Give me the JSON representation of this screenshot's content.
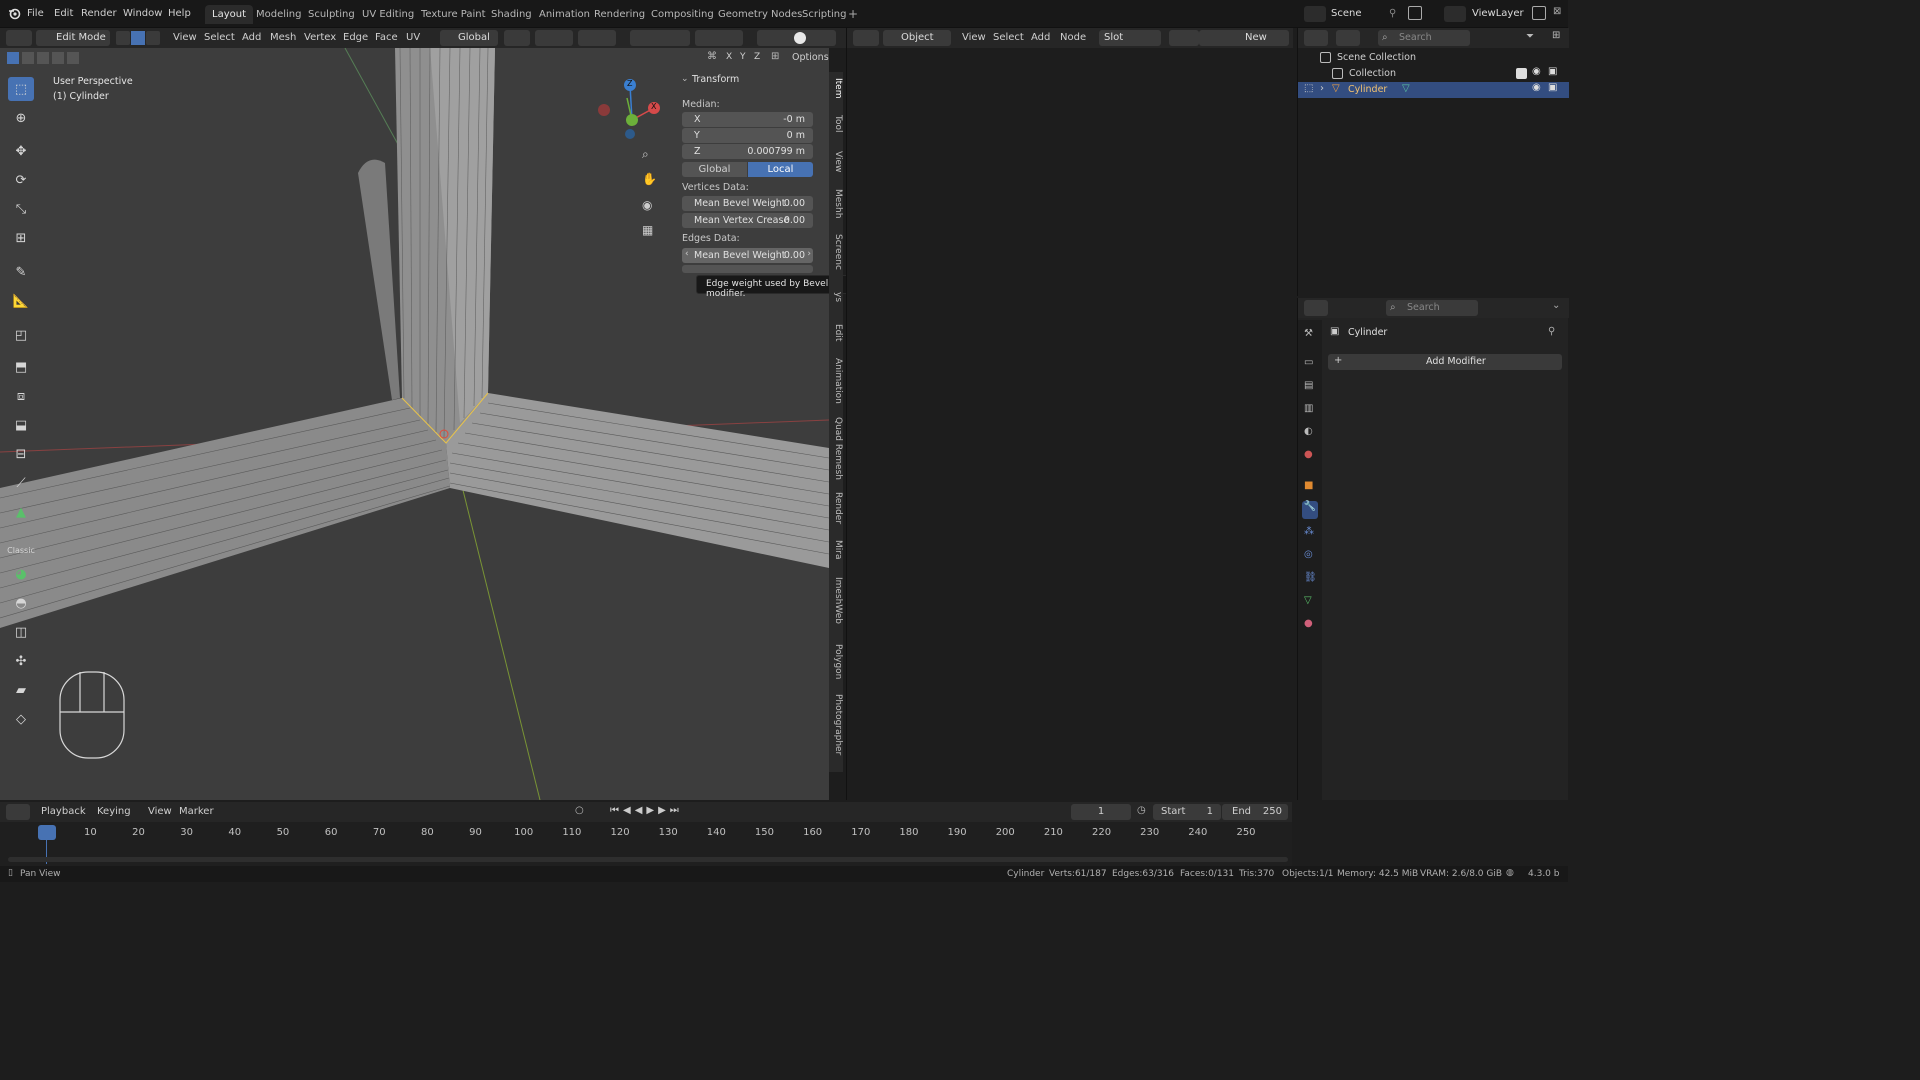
{
  "menubar": {
    "items": [
      "File",
      "Edit",
      "Render",
      "Window",
      "Help"
    ],
    "workspaces": [
      "Layout",
      "Modeling",
      "Sculpting",
      "UV Editing",
      "Texture Paint",
      "Shading",
      "Animation",
      "Rendering",
      "Compositing",
      "Geometry Nodes",
      "Scripting"
    ],
    "active_workspace": "Layout",
    "scene": "Scene",
    "view_layer": "ViewLayer"
  },
  "viewport_header": {
    "mode": "Edit Mode",
    "menus": [
      "View",
      "Select",
      "Add",
      "Mesh",
      "Vertex",
      "Edge",
      "Face",
      "UV"
    ],
    "orientation": "Global",
    "options_label": "Options",
    "axes": [
      "X",
      "Y",
      "Z"
    ]
  },
  "viewport": {
    "view_name": "User Perspective",
    "object_name": "(1) Cylinder",
    "gizmo_labels": [
      "X",
      "Y",
      "Z"
    ]
  },
  "npanel": {
    "section": "Transform",
    "median_label": "Median:",
    "fields": [
      {
        "label": "X",
        "value": "-0 m"
      },
      {
        "label": "Y",
        "value": "0 m"
      },
      {
        "label": "Z",
        "value": "0.000799 m"
      }
    ],
    "space_buttons": [
      "Global",
      "Local"
    ],
    "active_space": "Local",
    "vertices_label": "Vertices Data:",
    "vertex_fields": [
      {
        "label": "Mean Bevel Weight",
        "value": "0.00"
      },
      {
        "label": "Mean Vertex Crease",
        "value": "0.00"
      }
    ],
    "edges_label": "Edges Data:",
    "edge_fields": [
      {
        "label": "Mean Bevel Weight",
        "value": "0.00"
      }
    ],
    "tooltip": "Edge weight used by Bevel modifier."
  },
  "side_tabs": [
    "Item",
    "Tool",
    "View",
    "Meshh",
    "Screenc",
    "ys",
    "Edit",
    "Animation",
    "Quad Remesh",
    "Render",
    "Mira",
    "ImeshWeb",
    "Polygon",
    "Photographer"
  ],
  "node_header": {
    "object_label": "Object",
    "menus": [
      "View",
      "Select",
      "Add",
      "Node"
    ],
    "slot_label": "Slot",
    "new_label": "New"
  },
  "outliner": {
    "search_placeholder": "Search",
    "items": [
      {
        "label": "Scene Collection"
      },
      {
        "label": "Collection"
      },
      {
        "label": "Cylinder"
      }
    ]
  },
  "properties": {
    "search_placeholder": "Search",
    "object": "Cylinder",
    "add_modifier": "Add Modifier"
  },
  "timeline": {
    "menus": [
      "Playback",
      "Keying",
      "View",
      "Marker"
    ],
    "current_frame": "1",
    "start_label": "Start",
    "start": "1",
    "end_label": "End",
    "end": "250",
    "ticks": [
      "1",
      "10",
      "20",
      "30",
      "40",
      "50",
      "60",
      "70",
      "80",
      "90",
      "100",
      "110",
      "120",
      "130",
      "140",
      "150",
      "160",
      "170",
      "180",
      "190",
      "200",
      "210",
      "220",
      "230",
      "240",
      "250"
    ]
  },
  "statusbar": {
    "left": "Pan View",
    "object": "Cylinder",
    "verts": "Verts:61/187",
    "edges": "Edges:63/316",
    "faces": "Faces:0/131",
    "tris": "Tris:370",
    "objects": "Objects:1/1",
    "memory": "Memory: 42.5 MiB",
    "vram": "VRAM: 2.6/8.0 GiB",
    "version": "4.3.0 b"
  },
  "colors": {
    "accent": "#4772b3",
    "viewport_bg": "#3d3d3d"
  }
}
